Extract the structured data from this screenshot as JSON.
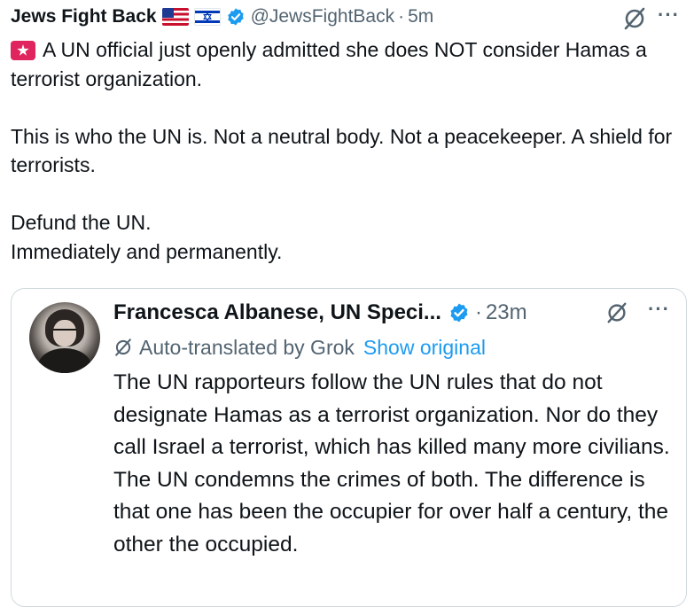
{
  "tweet": {
    "display_name": "Jews Fight Back",
    "handle": "@JewsFightBack",
    "separator": "·",
    "time": "5m",
    "more_label": "···",
    "body": {
      "line1": "A UN official just openly admitted she does NOT consider Hamas a terrorist organization.",
      "line2": "This is who the UN is. Not a neutral body. Not a peacekeeper. A shield for terrorists.",
      "line3": "Defund the UN.",
      "line4": "Immediately and permanently."
    }
  },
  "quote": {
    "display_name": "Francesca Albanese, UN Speci...",
    "separator": "·",
    "time": "23m",
    "more_label": "···",
    "translated_label": "Auto-translated by Grok",
    "show_original_label": "Show original",
    "body": {
      "line1": "The UN rapporteurs follow the UN rules that do not designate Hamas as a terrorist organization. Nor do they call Israel a terrorist, which has killed many more civilians.",
      "line2": "The UN condemns the crimes of both. The difference is that one has been the occupier for over half a century, the other the occupied."
    }
  },
  "colors": {
    "text_primary": "#0f1419",
    "text_secondary": "#536471",
    "link_blue": "#1d9bf0",
    "verified_blue": "#1d9bf0",
    "border": "#cfd9de",
    "siren_red": "#e0245e"
  },
  "icons": {
    "siren": "police-car-light-icon",
    "flag_us": "us-flag-icon",
    "flag_il": "israel-flag-icon",
    "verified": "verified-badge-icon",
    "grok": "grok-icon",
    "more": "more-icon"
  }
}
